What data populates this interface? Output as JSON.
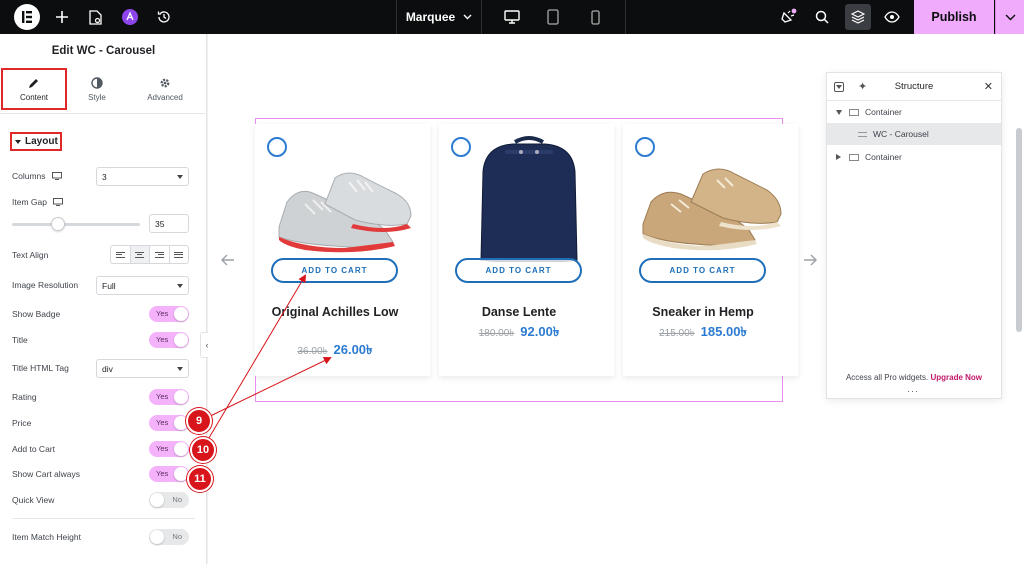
{
  "topbar": {
    "document_name": "Marquee",
    "publish_label": "Publish"
  },
  "panel": {
    "title": "Edit WC - Carousel",
    "tabs": [
      {
        "label": "Content",
        "icon": "pencil-icon",
        "active": true
      },
      {
        "label": "Style",
        "icon": "half-circle-icon",
        "active": false
      },
      {
        "label": "Advanced",
        "icon": "gear-icon",
        "active": false
      }
    ],
    "section_title": "Layout",
    "controls": {
      "columns": {
        "label": "Columns",
        "value": "3"
      },
      "item_gap": {
        "label": "Item Gap",
        "value": "35",
        "slider_fraction": 0.35
      },
      "text_align": {
        "label": "Text Align"
      },
      "image_resolution": {
        "label": "Image Resolution",
        "value": "Full"
      },
      "show_badge": {
        "label": "Show Badge",
        "state": "Yes"
      },
      "title": {
        "label": "Title",
        "state": "Yes"
      },
      "title_html_tag": {
        "label": "Title HTML Tag",
        "value": "div"
      },
      "rating": {
        "label": "Rating",
        "state": "Yes"
      },
      "price": {
        "label": "Price",
        "state": "Yes"
      },
      "add_to_cart": {
        "label": "Add to Cart",
        "state": "Yes"
      },
      "show_cart_always": {
        "label": "Show Cart always",
        "state": "Yes"
      },
      "quick_view": {
        "label": "Quick View",
        "state": "No"
      },
      "item_match_height": {
        "label": "Item Match Height",
        "state": "No"
      }
    }
  },
  "products": [
    {
      "title": "Original Achilles Low",
      "old_price": "36.00৳",
      "price": "26.00৳",
      "cart_label": "ADD TO CART",
      "image": "sneaker-grey"
    },
    {
      "title": "Danse Lente",
      "old_price": "180.00৳",
      "price": "92.00৳",
      "cart_label": "ADD TO CART",
      "image": "backpack-navy"
    },
    {
      "title": "Sneaker in Hemp",
      "old_price": "215.00৳",
      "price": "185.00৳",
      "cart_label": "ADD TO CART",
      "image": "sneaker-tan"
    }
  ],
  "annotations": [
    "9",
    "10",
    "11"
  ],
  "structure": {
    "title": "Structure",
    "items": [
      {
        "label": "Container"
      },
      {
        "label": "WC - Carousel"
      },
      {
        "label": "Container"
      }
    ],
    "promo_text": "Access all Pro widgets.",
    "upgrade_label": "Upgrade Now"
  },
  "colors": {
    "accent_pink": "#f0abfc",
    "price_blue": "#2b7bd3",
    "annotation_red": "#d8151b"
  }
}
